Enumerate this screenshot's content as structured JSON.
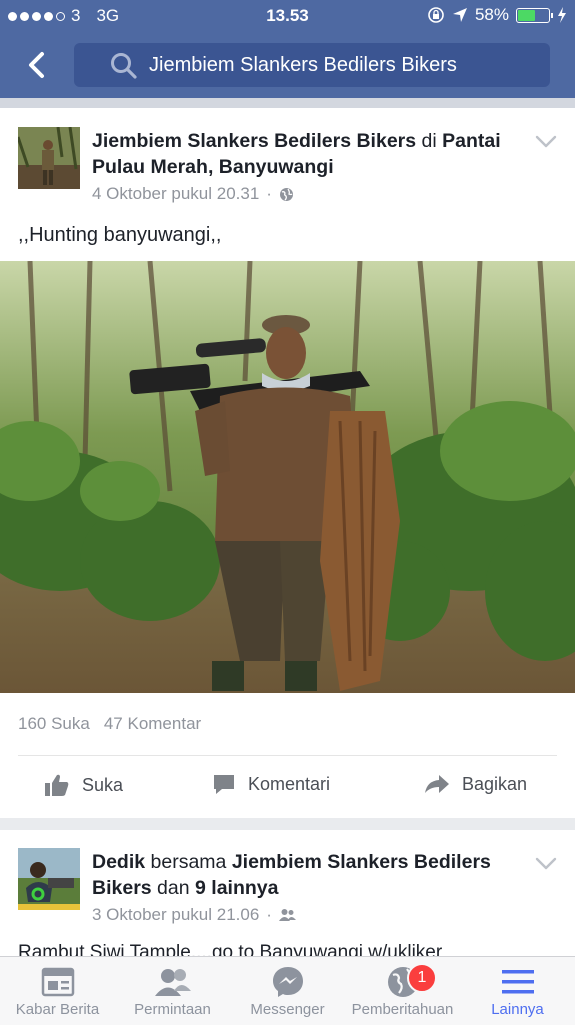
{
  "status": {
    "carrier": "3",
    "network": "3G",
    "time": "13.53",
    "battery": "58%"
  },
  "search": {
    "query": "Jiembiem Slankers Bedilers Bikers"
  },
  "post1": {
    "author": "Jiembiem Slankers Bedilers Bikers",
    "connector": "di",
    "location": "Pantai Pulau Merah, Banyuwangi",
    "time": "4 Oktober pukul 20.31",
    "separator": "·",
    "text": ",,Hunting banyuwangi,,",
    "likes": "160 Suka",
    "comments": "47 Komentar"
  },
  "actions": {
    "like": "Suka",
    "comment": "Komentari",
    "share": "Bagikan"
  },
  "post2": {
    "author": "Dedik",
    "connector": "bersama",
    "with": "Jiembiem Slankers Bedilers Bikers",
    "and": "dan",
    "others": "9 lainnya",
    "time": "3 Oktober pukul 21.06",
    "separator": "·",
    "text": "Rambut Siwi Tample....go to Banyuwangi w/ukliker"
  },
  "tabs": [
    {
      "label": "Kabar Berita",
      "icon": "news-feed-icon"
    },
    {
      "label": "Permintaan",
      "icon": "friends-icon"
    },
    {
      "label": "Messenger",
      "icon": "messenger-icon"
    },
    {
      "label": "Pemberitahuan",
      "icon": "globe-icon",
      "badge": "1"
    },
    {
      "label": "Lainnya",
      "icon": "menu-icon"
    }
  ],
  "colors": {
    "header": "#4e69a2",
    "active_tab": "#4e6ef0",
    "badge": "#fa3e3e"
  }
}
